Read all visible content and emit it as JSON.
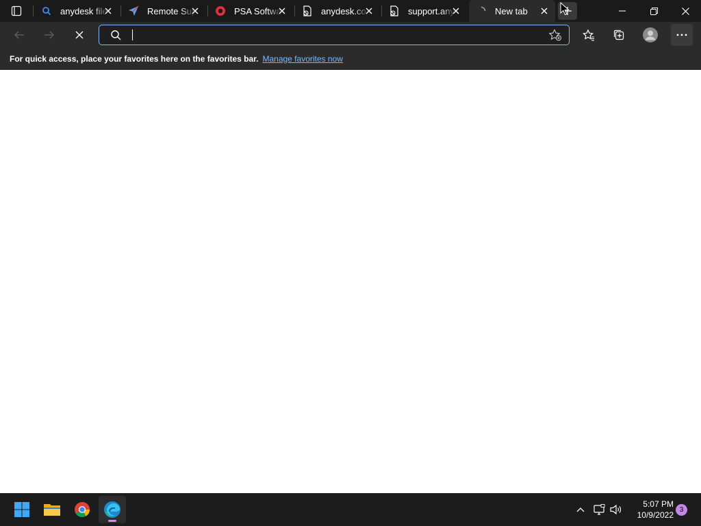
{
  "browser": {
    "tabs": [
      {
        "title": "anydesk file",
        "icon": "search-icon"
      },
      {
        "title": "Remote Sup",
        "icon": "paper-plane-icon"
      },
      {
        "title": "PSA Softwa",
        "icon": "ring-icon"
      },
      {
        "title": "anydesk.co",
        "icon": "document-blocked-icon"
      },
      {
        "title": "support.any",
        "icon": "document-blocked-icon"
      },
      {
        "title": "New tab",
        "icon": "loading-icon",
        "active": true
      }
    ],
    "address_bar": {
      "value": "",
      "placeholder": ""
    },
    "favorites_bar": {
      "message": "For quick access, place your favorites here on the favorites bar.",
      "link": "Manage favorites now"
    }
  },
  "taskbar": {
    "apps": [
      "start-icon",
      "file-explorer-icon",
      "chrome-icon",
      "edge-icon"
    ],
    "clock": {
      "time": "5:07 PM",
      "date": "10/9/2022"
    },
    "notification_count": "3"
  },
  "colors": {
    "titlebar": "#1a1a1a",
    "toolbar": "#2b2b2b",
    "accent": "#8ab4f8",
    "link": "#79b8ff",
    "taskbar": "#1c1c1c"
  }
}
